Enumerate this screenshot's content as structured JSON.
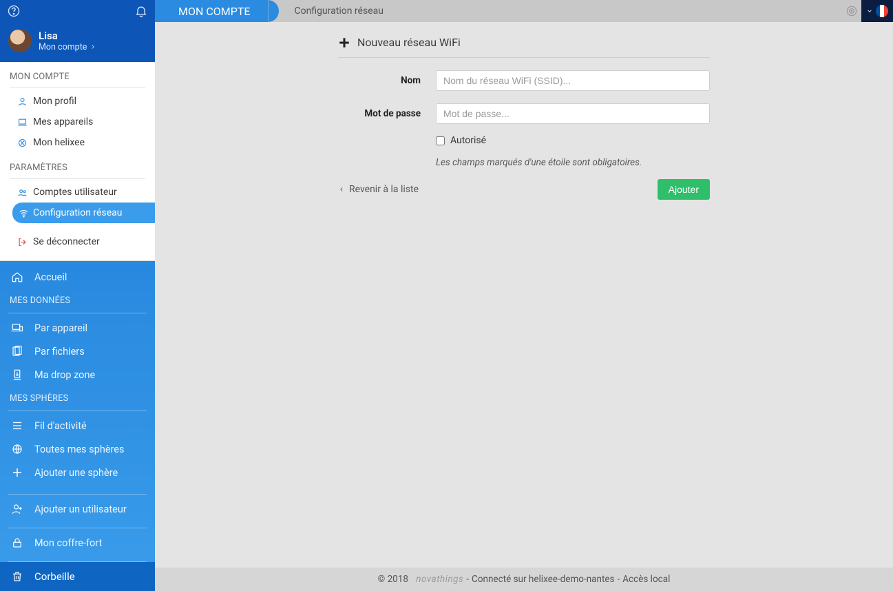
{
  "user": {
    "name": "Lisa",
    "sub": "Mon compte"
  },
  "account": {
    "heading": "MON COMPTE",
    "items": {
      "profile": "Mon profil",
      "devices": "Mes appareils",
      "helixee": "Mon helixee"
    },
    "settings_heading": "PARAMÈTRES",
    "settings": {
      "users": "Comptes utilisateur",
      "network": "Configuration réseau"
    },
    "logout": "Se déconnecter"
  },
  "nav": {
    "home": "Accueil",
    "data_heading": "MES DONNÉES",
    "by_device": "Par appareil",
    "by_files": "Par fichiers",
    "dropzone": "Ma drop zone",
    "spheres_heading": "MES SPHÈRES",
    "activity": "Fil d'activité",
    "all_spheres": "Toutes mes sphères",
    "add_sphere": "Ajouter une sphère",
    "add_user": "Ajouter un utilisateur",
    "vault": "Mon coffre-fort",
    "trash": "Corbeille"
  },
  "topbar": {
    "tab": "MON COMPTE",
    "crumb": "Configuration réseau"
  },
  "form": {
    "title": "Nouveau réseau WiFi",
    "name_label": "Nom",
    "name_placeholder": "Nom du réseau WiFi (SSID)...",
    "password_label": "Mot de passe",
    "password_placeholder": "Mot de passe...",
    "authorized_label": "Autorisé",
    "note": "Les champs marqués d'une étoile sont obligatoires.",
    "back": "Revenir à la liste",
    "submit": "Ajouter"
  },
  "footer": {
    "copyright": "© 2018",
    "brand": "novathings",
    "sep1": " - ",
    "connected": "Connecté sur helixee-demo-nantes",
    "sep2": " - ",
    "access": "Accès local"
  }
}
